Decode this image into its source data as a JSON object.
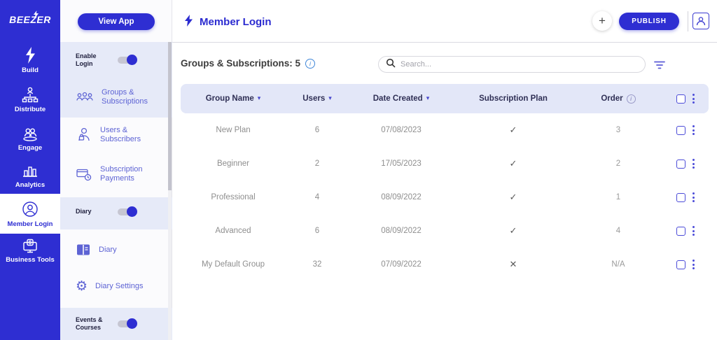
{
  "brand": {
    "name": "BEEZER"
  },
  "left_nav": {
    "items": [
      {
        "label": "Build"
      },
      {
        "label": "Distribute"
      },
      {
        "label": "Engage"
      },
      {
        "label": "Analytics"
      },
      {
        "label": "Member Login"
      },
      {
        "label": "Business Tools"
      }
    ]
  },
  "sub_nav": {
    "view_app_label": "View App",
    "enable_login_label": "Enable Login",
    "groups_label": "Groups & Subscriptions",
    "users_label": "Users & Subscribers",
    "payments_label": "Subscription Payments",
    "diary_toggle_label": "Diary",
    "diary_label": "Diary",
    "diary_settings_label": "Diary Settings",
    "events_label": "Events & Courses"
  },
  "topbar": {
    "title": "Member Login",
    "plus_label": "+",
    "publish_label": "PUBLISH"
  },
  "content": {
    "heading": "Groups & Subscriptions: 5",
    "info_glyph": "i",
    "search_placeholder": "Search..."
  },
  "table": {
    "columns": [
      "Group Name",
      "Users",
      "Date Created",
      "Subscription Plan",
      "Order"
    ],
    "rows": [
      {
        "group_name": "New Plan",
        "users": "6",
        "date_created": "07/08/2023",
        "subscription_plan": true,
        "order": "3"
      },
      {
        "group_name": "Beginner",
        "users": "2",
        "date_created": "17/05/2023",
        "subscription_plan": true,
        "order": "2"
      },
      {
        "group_name": "Professional",
        "users": "4",
        "date_created": "08/09/2022",
        "subscription_plan": true,
        "order": "1"
      },
      {
        "group_name": "Advanced",
        "users": "6",
        "date_created": "08/09/2022",
        "subscription_plan": true,
        "order": "4"
      },
      {
        "group_name": "My Default Group",
        "users": "32",
        "date_created": "07/09/2022",
        "subscription_plan": false,
        "order": "N/A"
      }
    ]
  },
  "colors": {
    "brand_blue": "#2e2ed2",
    "lavender_section": "#e6eaf8",
    "table_header_bg": "#e3e7f8",
    "row_text": "#8e8e8e",
    "accent_link": "#5d63d4",
    "info_blue": "#3f86d8"
  }
}
